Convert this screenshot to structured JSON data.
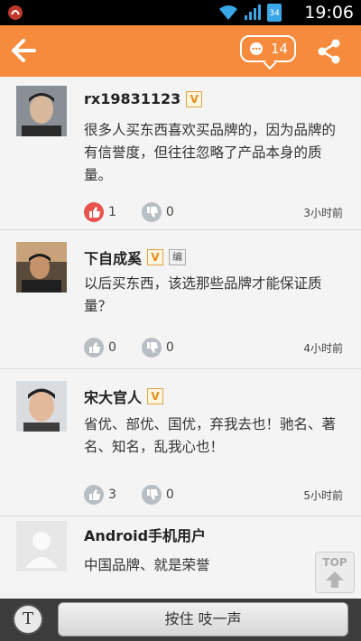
{
  "status_bar": {
    "time": "19:06",
    "app_icon": "notification-app-icon",
    "icons": [
      "wifi-icon",
      "signal-icon",
      "battery-icon"
    ],
    "battery_level": "34"
  },
  "header": {
    "back_icon": "arrow-left-icon",
    "comment_icon": "comment-bubble-icon",
    "comment_count": "14",
    "share_icon": "share-icon",
    "background_color": "#f78b3d"
  },
  "comments": [
    {
      "username": "rx19831123",
      "badge_v": "V",
      "content": "很多人买东西喜欢买品牌的，因为品牌的有信誉度，但往往忽略了产品本身的质量。",
      "likes": "1",
      "dislikes": "0",
      "time": "3小时前",
      "liked": true
    },
    {
      "username": "下自成奚",
      "badge_v": "V",
      "badge_edit": "编",
      "content": "以后买东西，该选那些品牌才能保证质量？",
      "likes": "0",
      "dislikes": "0",
      "time": "4小时前",
      "liked": false
    },
    {
      "username": "宋大官人",
      "badge_v": "V",
      "content": "省优、部优、国优，弃我去也！驰名、著名、知名，乱我心也！",
      "likes": "3",
      "dislikes": "0",
      "time": "5小时前",
      "liked": false
    },
    {
      "username": "Android手机用户",
      "content": "中国品牌、就是荣誉"
    }
  ],
  "top_button": {
    "label": "TOP"
  },
  "bottom_bar": {
    "text_toggle": "T",
    "hold_label": "按住 吱一声"
  }
}
